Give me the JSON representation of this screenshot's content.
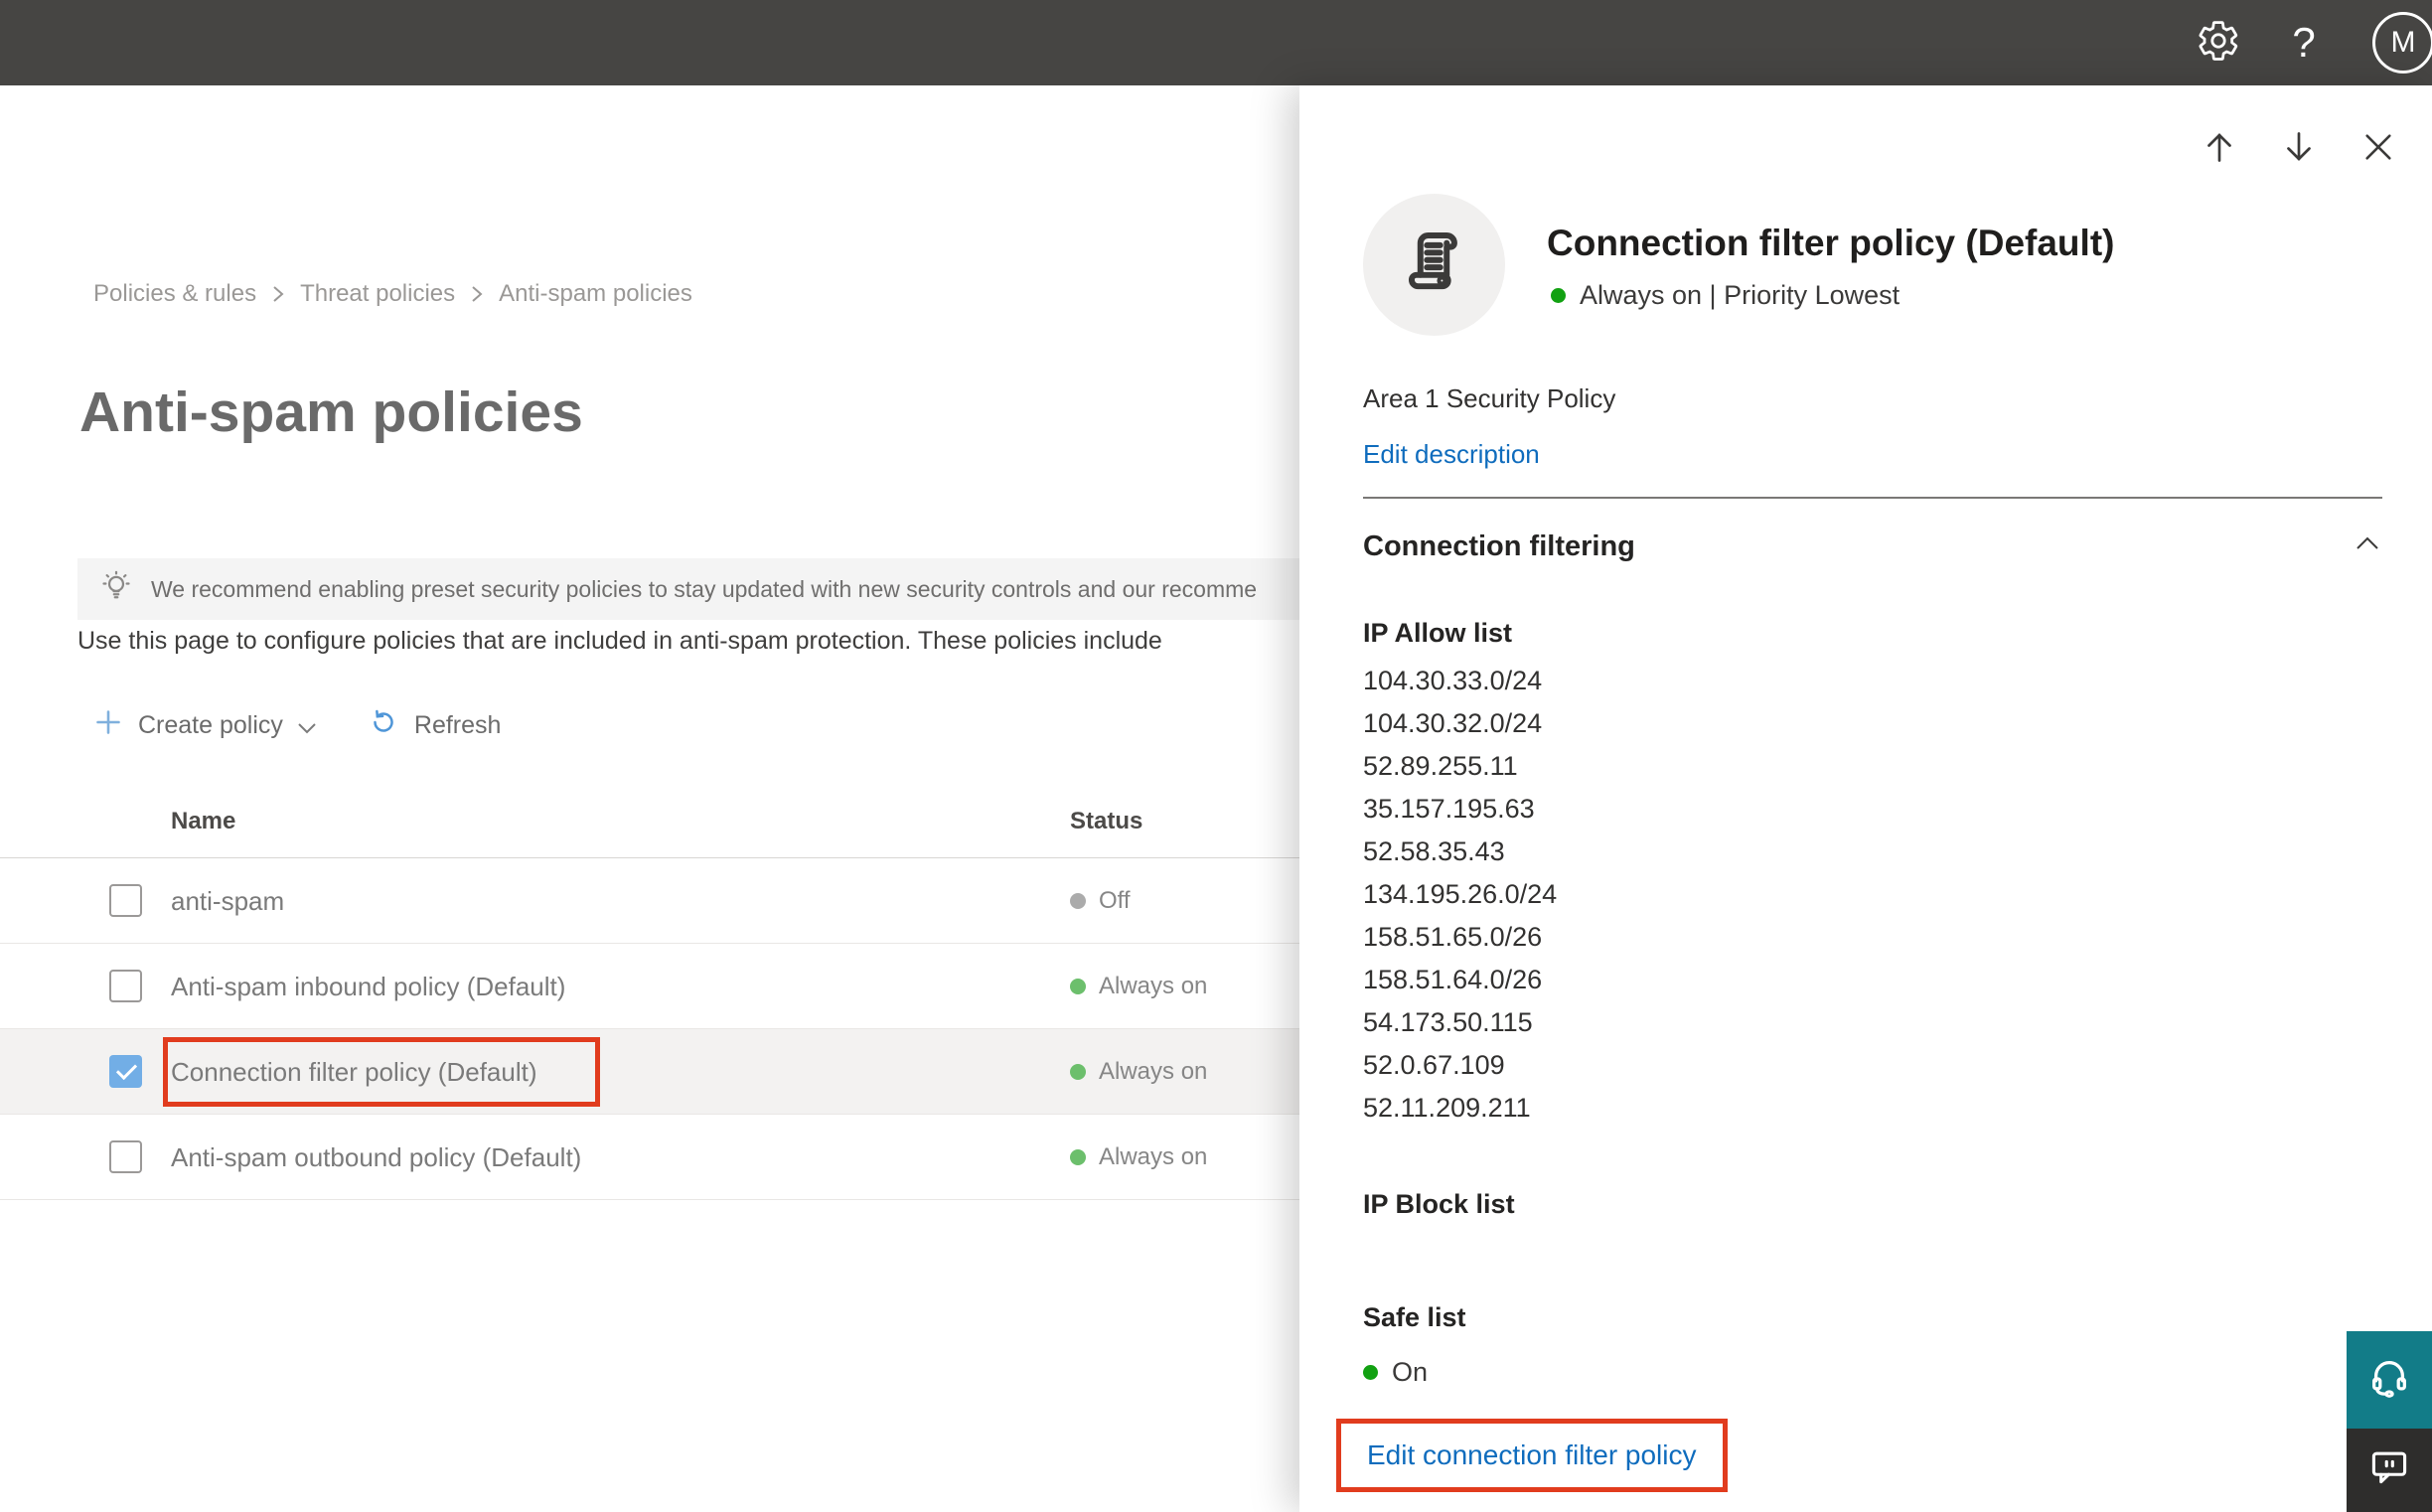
{
  "topbar": {
    "help_label": "?",
    "avatar_initial": "M"
  },
  "breadcrumb": {
    "items": [
      "Policies & rules",
      "Threat policies",
      "Anti-spam policies"
    ]
  },
  "page": {
    "title": "Anti-spam policies",
    "banner_text": "We recommend enabling preset security policies to stay updated with new security controls and our recomme",
    "description": "Use this page to configure policies that are included in anti-spam protection. These policies include",
    "create_policy_label": "Create policy",
    "refresh_label": "Refresh"
  },
  "table": {
    "columns": {
      "name": "Name",
      "status": "Status"
    },
    "rows": [
      {
        "name": "anti-spam",
        "status": "Off",
        "status_state": "off",
        "checked": false,
        "selected": false,
        "outlined": false
      },
      {
        "name": "Anti-spam inbound policy (Default)",
        "status": "Always on",
        "status_state": "on",
        "checked": false,
        "selected": false,
        "outlined": false
      },
      {
        "name": "Connection filter policy (Default)",
        "status": "Always on",
        "status_state": "on",
        "checked": true,
        "selected": true,
        "outlined": true
      },
      {
        "name": "Anti-spam outbound policy (Default)",
        "status": "Always on",
        "status_state": "on",
        "checked": false,
        "selected": false,
        "outlined": false
      }
    ]
  },
  "panel": {
    "title": "Connection filter policy (Default)",
    "status_line": "Always on | Priority Lowest",
    "description": "Area 1 Security Policy",
    "edit_description_label": "Edit description",
    "section_title": "Connection filtering",
    "ip_allow": {
      "label": "IP Allow list",
      "ips": [
        "104.30.33.0/24",
        "104.30.32.0/24",
        "52.89.255.11",
        "35.157.195.63",
        "52.58.35.43",
        "134.195.26.0/24",
        "158.51.65.0/26",
        "158.51.64.0/26",
        "54.173.50.115",
        "52.0.67.109",
        "52.11.209.211"
      ]
    },
    "ip_block_label": "IP Block list",
    "safe_list_label": "Safe list",
    "safe_list_status": "On",
    "edit_link_label": "Edit connection filter policy"
  },
  "colors": {
    "topbar": "#464543",
    "accent_link": "#0f6cbd",
    "red_outline": "#e13c1e",
    "checkbox_checked": "#72aee6",
    "status_on_table": "#6cbf6c",
    "status_off": "#ababab",
    "status_on_panel": "#12a112",
    "headset_button": "#127c88",
    "feedback_button": "#2e2d2c"
  }
}
